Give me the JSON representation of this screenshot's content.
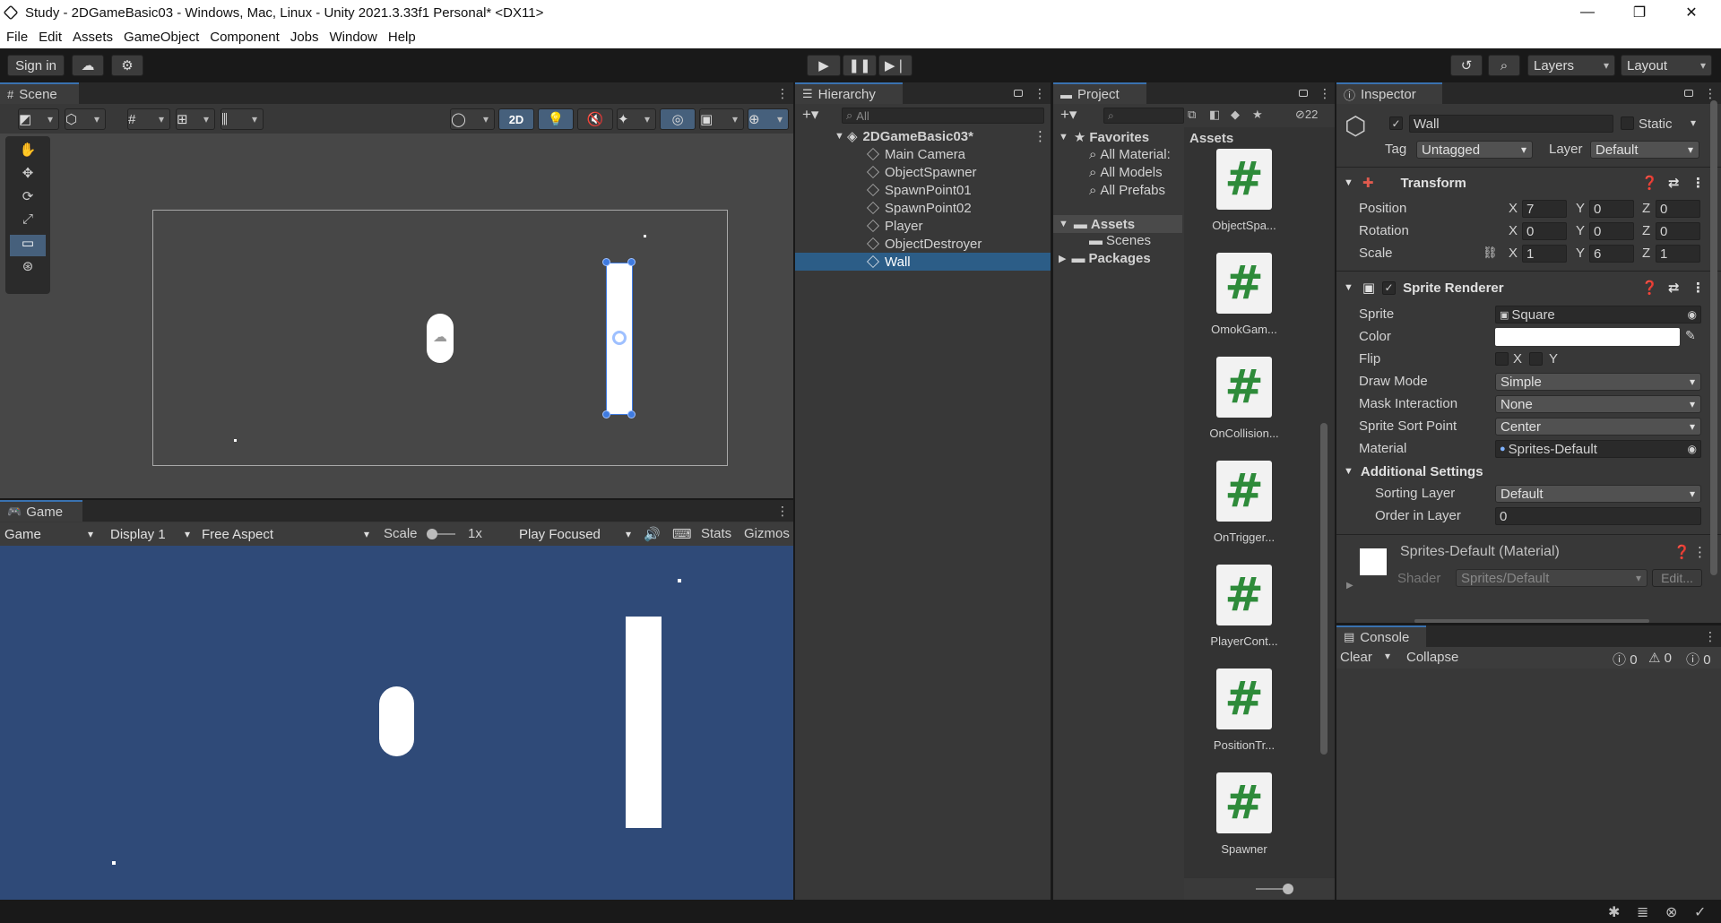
{
  "window": {
    "title": "Study - 2DGameBasic03 - Windows, Mac, Linux - Unity 2021.3.33f1 Personal* <DX11>"
  },
  "menu": [
    "File",
    "Edit",
    "Assets",
    "GameObject",
    "Component",
    "Jobs",
    "Window",
    "Help"
  ],
  "toolbar": {
    "sign_in": "Sign in",
    "layers": "Layers",
    "layout": "Layout"
  },
  "scene": {
    "tab": "Scene",
    "mode_2d": "2D"
  },
  "game": {
    "tab": "Game",
    "view_dd": "Game",
    "display": "Display 1",
    "aspect": "Free Aspect",
    "scale_label": "Scale",
    "scale_value": "1x",
    "play_focused": "Play Focused",
    "stats": "Stats",
    "gizmos": "Gizmos"
  },
  "hierarchy": {
    "tab": "Hierarchy",
    "search_placeholder": "All",
    "scene_name": "2DGameBasic03*",
    "items": [
      "Main Camera",
      "ObjectSpawner",
      "SpawnPoint01",
      "SpawnPoint02",
      "Player",
      "ObjectDestroyer",
      "Wall"
    ]
  },
  "project": {
    "tab": "Project",
    "hidden_count": "22",
    "favorites": "Favorites",
    "fav_items": [
      "All Material:",
      "All Models",
      "All Prefabs"
    ],
    "assets": "Assets",
    "asset_folders": [
      "Scenes"
    ],
    "packages": "Packages",
    "grid_header": "Assets",
    "scripts": [
      "ObjectSpa...",
      "OmokGam...",
      "OnCollision...",
      "OnTrigger...",
      "PlayerCont...",
      "PositionTr...",
      "Spawner"
    ]
  },
  "inspector": {
    "tab": "Inspector",
    "object_name": "Wall",
    "static_label": "Static",
    "tag_label": "Tag",
    "tag_value": "Untagged",
    "layer_label": "Layer",
    "layer_value": "Default",
    "transform": {
      "title": "Transform",
      "position_label": "Position",
      "position": [
        "7",
        "0",
        "0"
      ],
      "rotation_label": "Rotation",
      "rotation": [
        "0",
        "0",
        "0"
      ],
      "scale_label": "Scale",
      "scale": [
        "1",
        "6",
        "1"
      ]
    },
    "sprite_renderer": {
      "title": "Sprite Renderer",
      "sprite_label": "Sprite",
      "sprite_value": "Square",
      "color_label": "Color",
      "flip_label": "Flip",
      "flip_x": "X",
      "flip_y": "Y",
      "draw_mode_label": "Draw Mode",
      "draw_mode": "Simple",
      "mask_label": "Mask Interaction",
      "mask": "None",
      "sort_point_label": "Sprite Sort Point",
      "sort_point": "Center",
      "material_label": "Material",
      "material": "Sprites-Default",
      "additional": "Additional Settings",
      "sorting_layer_label": "Sorting Layer",
      "sorting_layer": "Default",
      "order_label": "Order in Layer",
      "order": "0"
    },
    "material_section": {
      "title": "Sprites-Default (Material)",
      "shader_label": "Shader",
      "shader_value": "Sprites/Default",
      "edit": "Edit..."
    },
    "axes": [
      "X",
      "Y",
      "Z"
    ]
  },
  "console": {
    "tab": "Console",
    "clear": "Clear",
    "collapse": "Collapse",
    "counts": [
      "0",
      "0",
      "0"
    ]
  },
  "colors": {
    "accent": "#3a72b0",
    "game_bg": "#2f4a78",
    "scene_bg": "#474747",
    "selection": "#2c5d87"
  }
}
